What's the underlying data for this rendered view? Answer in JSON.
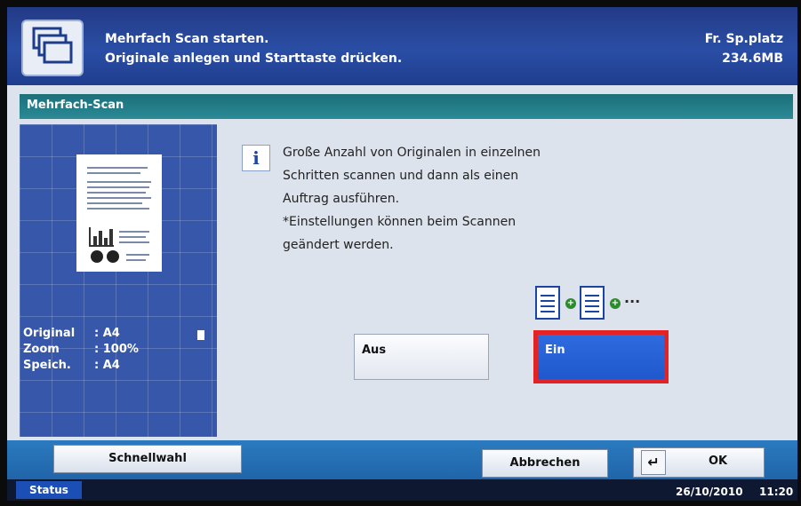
{
  "header": {
    "message_line1": "Mehrfach Scan starten.",
    "message_line2": "Originale anlegen und Starttaste drücken.",
    "storage_label": "Fr. Sp.platz",
    "storage_value": "234.6MB"
  },
  "section": {
    "title": "Mehrfach-Scan"
  },
  "preview": {
    "rows": [
      {
        "key": "Original",
        "value": ": A4"
      },
      {
        "key": "Zoom",
        "value": ": 100%"
      },
      {
        "key": "Speich.",
        "value": ": A4"
      }
    ]
  },
  "info": {
    "lines": [
      "Große Anzahl von Originalen in einzelnen",
      "Schritten scannen und dann als einen",
      "Auftrag ausführen.",
      "*Einstellungen können beim Scannen",
      "geändert werden."
    ]
  },
  "options": {
    "off_label": "Aus",
    "on_label": "Ein",
    "selected": "Ein"
  },
  "bottom": {
    "quick_label": "Schnellwahl",
    "cancel_label": "Abbrechen",
    "ok_label": "OK",
    "status_label": "Status",
    "date": "26/10/2010",
    "time": "11:20"
  },
  "icons": {
    "header": "multi-document-icon",
    "info": "info-icon",
    "ok": "enter-arrow-icon",
    "option": "multi-scan-pages-icon"
  },
  "colors": {
    "header_bg": "#2a4ea5",
    "section_bar": "#2a8a95",
    "selected_button": "#1e58cc",
    "selection_frame": "#e32323"
  }
}
